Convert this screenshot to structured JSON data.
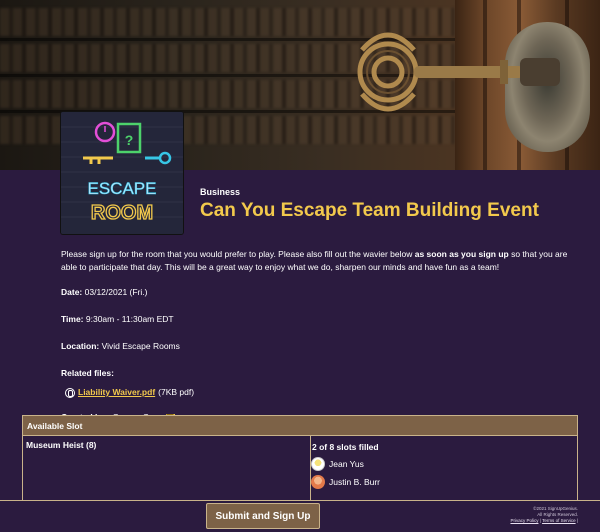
{
  "hero": {
    "thumbnail": {
      "line1": "ESCAPE",
      "line2": "ROOM"
    }
  },
  "event": {
    "category": "Business",
    "title": "Can You Escape Team Building Event",
    "intro_part1": "Please sign up for the room that you would prefer to play. Please also fill out the wavier below ",
    "intro_bold": "as soon as you sign up",
    "intro_part2": " so that you are able to participate that day. This will be a great way to enjoy what we do, sharpen our minds and have fun as a team!",
    "date_label": "Date:",
    "date_value": " 03/12/2021 (Fri.)",
    "time_label": "Time:",
    "time_value": " 9:30am - 11:30am EDT",
    "location_label": "Location:",
    "location_value": " Vivid Escape Rooms",
    "related_files_label": "Related files:",
    "file_name": " Liability Waiver.pdf ",
    "file_meta": "(7KB pdf)",
    "created_by_label": "Created by:",
    "created_by_value": "Omega Corp"
  },
  "slots": {
    "header": "Available Slot",
    "rows": [
      {
        "name": "Museum Heist (8)",
        "filled_text": "2 of 8 slots filled",
        "people": [
          "Jean Yus",
          "Justin B. Burr"
        ]
      }
    ]
  },
  "footer": {
    "submit_label": "Submit and Sign Up",
    "copyright": "©2021 SignUpGenius.",
    "rights": "All Rights Reserved.",
    "privacy": "Privacy Policy",
    "separator": " | ",
    "terms": "Terms of Service",
    "trailing": " |"
  },
  "colors": {
    "background": "#2b1b3f",
    "accent_gold": "#f2c94c",
    "panel_brown": "#7d6247",
    "border": "#c9b38a"
  }
}
